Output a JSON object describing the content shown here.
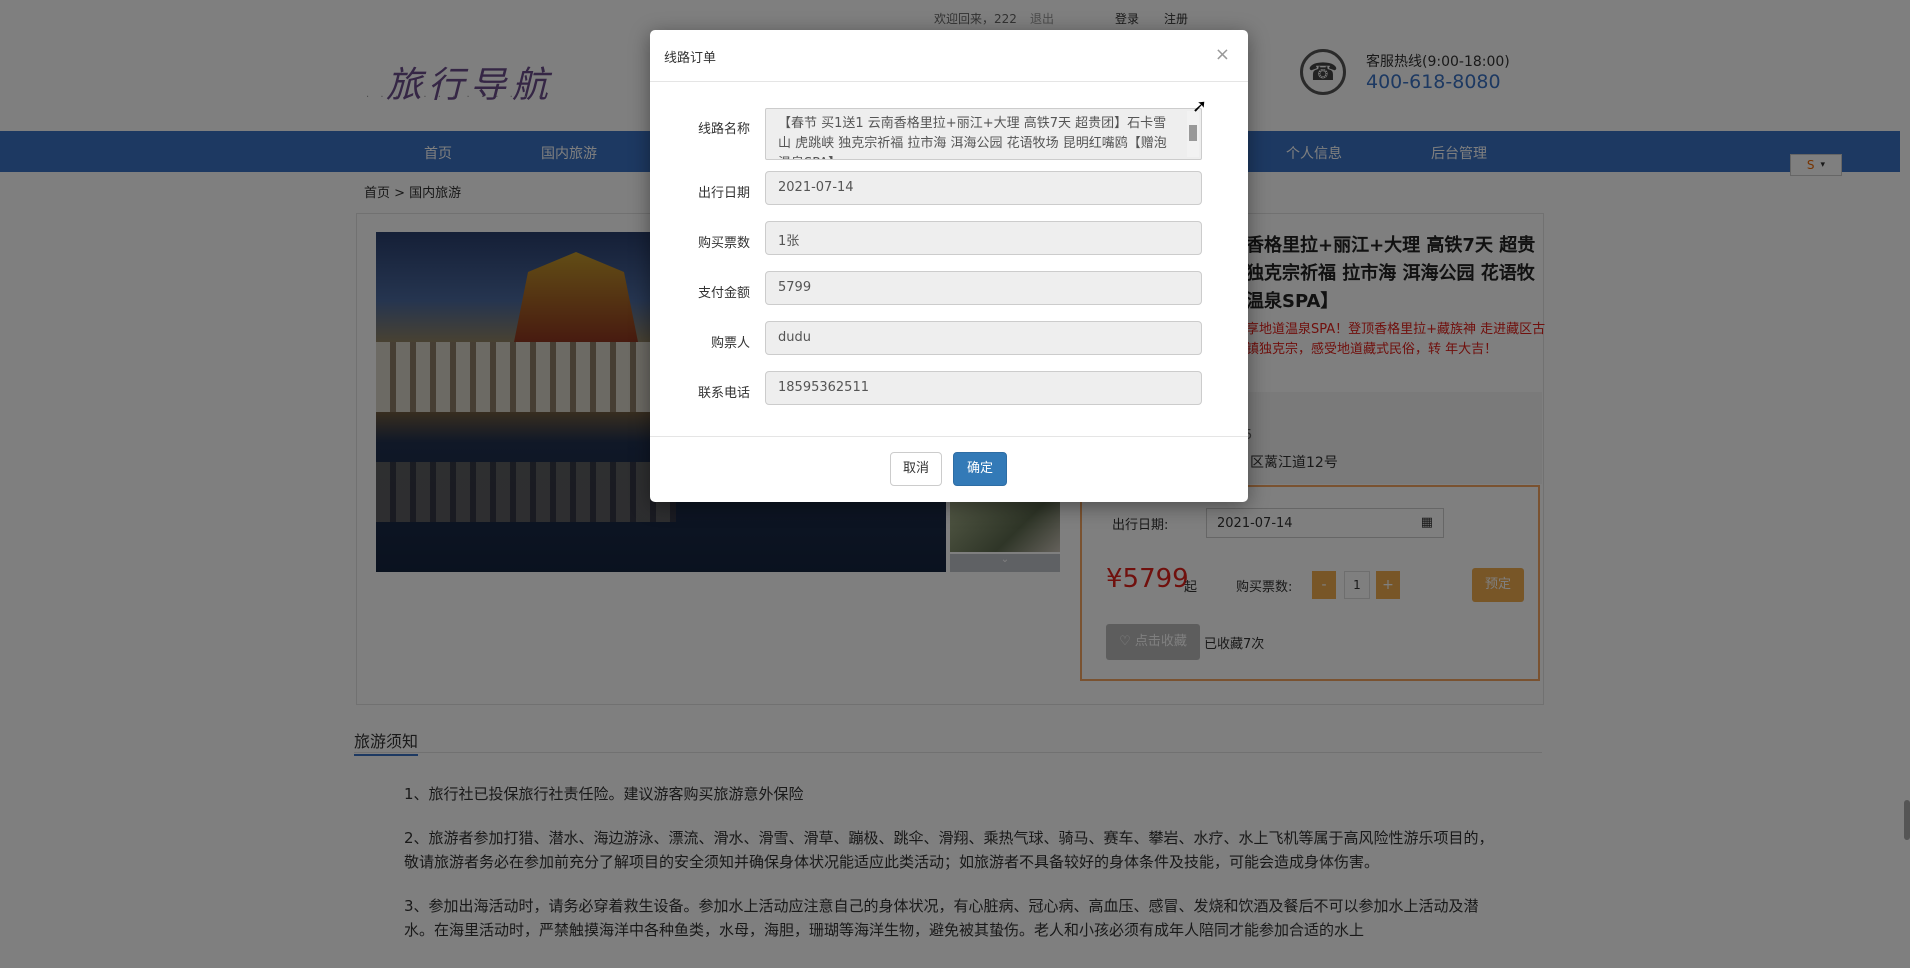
{
  "topbar": {
    "welcome": "欢迎回来，222",
    "logout": "退出",
    "login": "登录",
    "register": "注册"
  },
  "header": {
    "logo_text": "旅行导航",
    "hotline_label": "客服热线(9:00-18:00)",
    "hotline_number": "400-618-8080"
  },
  "nav": {
    "items": [
      "首页",
      "国内旅游",
      "个人信息",
      "后台管理"
    ]
  },
  "breadcrumb": "首页 > 国内旅游",
  "product": {
    "title": "香格里拉+丽江+大理 高铁7天 超贵 独克宗祈福 拉市海 洱海公园 花语牧 温泉SPA】",
    "promo": "享地道温泉SPA！登顶香格里拉+藏族神 走进藏区古镇独克宗，感受地道藏式民俗，转 年大吉！",
    "num_partial": "5",
    "address_partial": "区蓠江道12号",
    "travel_date_label": "出行日期:",
    "travel_date": "2021-07-14",
    "price": "¥5799",
    "price_suffix": "起",
    "qty_label": "购买票数:",
    "qty_minus": "-",
    "qty_value": "1",
    "qty_plus": "+",
    "book_label": "预定",
    "fav_label": "♡ 点击收藏",
    "fav_count": "已收藏7次"
  },
  "notice": {
    "title": "旅游须知",
    "items": [
      "1、旅行社已投保旅行社责任险。建议游客购买旅游意外保险",
      "2、旅游者参加打猎、潜水、海边游泳、漂流、滑水、滑雪、滑草、蹦极、跳伞、滑翔、乘热气球、骑马、赛车、攀岩、水疗、水上飞机等属于高风险性游乐项目的，敬请旅游者务必在参加前充分了解项目的安全须知并确保身体状况能适应此类活动；如旅游者不具备较好的身体条件及技能，可能会造成身体伤害。",
      "3、参加出海活动时，请务必穿着救生设备。参加水上活动应注意自己的身体状况，有心脏病、冠心病、高血压、感冒、发烧和饮酒及餐后不可以参加水上活动及潜水。在海里活动时，严禁触摸海洋中各种鱼类，水母，海胆，珊瑚等海洋生物，避免被其蛰伤。老人和小孩必须有成年人陪同才能参加合适的水上"
    ]
  },
  "modal": {
    "title": "线路订单",
    "close": "×",
    "fields": {
      "route_label": "线路名称",
      "route_value": "【春节 买1送1 云南香格里拉+丽江+大理 高铁7天 超贵团】石卡雪山 虎跳峡 独克宗祈福 拉市海 洱海公园 花语牧场 昆明红嘴鸥【赠泡温泉SPA】",
      "date_label": "出行日期",
      "date_value": "2021-07-14",
      "tickets_label": "购买票数",
      "tickets_value": "1张",
      "amount_label": "支付金额",
      "amount_value": "5799",
      "buyer_label": "购票人",
      "buyer_value": "dudu",
      "phone_label": "联系电话",
      "phone_value": "18595362511"
    },
    "cancel_label": "取消",
    "ok_label": "确定"
  },
  "colors": {
    "brand": "#3b73c4",
    "price": "#e0201a",
    "accent": "#f0ad4e",
    "primary_button": "#337ab7"
  }
}
